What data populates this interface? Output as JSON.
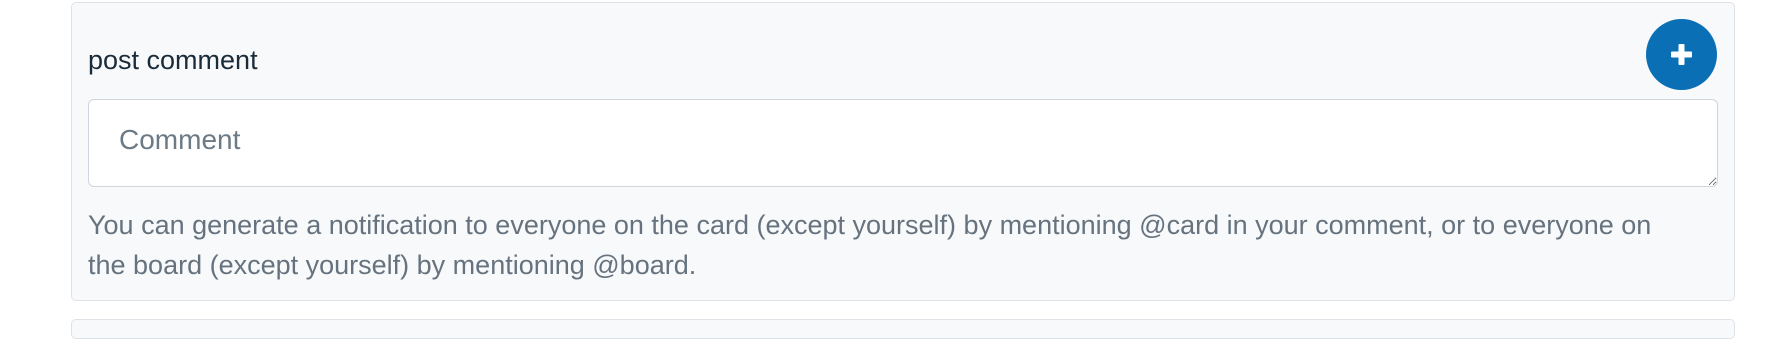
{
  "comment_panel": {
    "title": "post comment",
    "add_button_icon": "plus-icon",
    "add_button_color": "#0a6fb5",
    "input_placeholder": "Comment",
    "input_value": "",
    "help_text": "You can generate a notification to everyone on the card (except yourself) by mentioning @card in your comment, or to everyone on the board (except yourself) by mentioning @board."
  }
}
